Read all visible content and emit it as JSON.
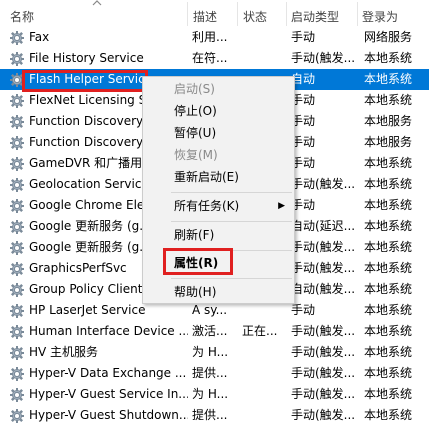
{
  "header": {
    "name": "名称",
    "desc": "描述",
    "status": "状态",
    "startup": "启动类型",
    "logon": "登录为"
  },
  "services": [
    {
      "name": "Fax",
      "desc": "利用...",
      "status": "",
      "startup": "手动",
      "logon": "网络服务"
    },
    {
      "name": "File History Service",
      "desc": "在符...",
      "status": "",
      "startup": "手动(触发...",
      "logon": "本地系统"
    },
    {
      "name": "Flash Helper Service",
      "desc": "",
      "status": "",
      "startup": "自动",
      "logon": "本地系统",
      "selected": true
    },
    {
      "name": "FlexNet Licensing Se...",
      "desc": "",
      "status": "",
      "startup": "手动",
      "logon": "本地系统"
    },
    {
      "name": "Function Discovery...",
      "desc": "",
      "status": "",
      "startup": "手动",
      "logon": "本地服务"
    },
    {
      "name": "Function Discovery...",
      "desc": "",
      "status": "",
      "startup": "手动",
      "logon": "本地服务"
    },
    {
      "name": "GameDVR 和广播用户...",
      "desc": "",
      "status": "",
      "startup": "手动",
      "logon": "本地系统"
    },
    {
      "name": "Geolocation Service",
      "desc": "",
      "status": "",
      "startup": "手动(触发...",
      "logon": "本地系统"
    },
    {
      "name": "Google Chrome Ele...",
      "desc": "",
      "status": "",
      "startup": "手动",
      "logon": "本地系统"
    },
    {
      "name": "Google 更新服务 (g...",
      "desc": "",
      "status": "",
      "startup": "自动(延迟...",
      "logon": "本地系统"
    },
    {
      "name": "Google 更新服务 (g...",
      "desc": "",
      "status": "",
      "startup": "手动(触发...",
      "logon": "本地系统"
    },
    {
      "name": "GraphicsPerfSvc",
      "desc": "",
      "status": "",
      "startup": "手动(触发...",
      "logon": "本地系统"
    },
    {
      "name": "Group Policy Client",
      "desc": "",
      "status": "",
      "startup": "自动(触发...",
      "logon": "本地系统"
    },
    {
      "name": "HP LaserJet Service",
      "desc": "A sy...",
      "status": "",
      "startup": "手动",
      "logon": "本地系统"
    },
    {
      "name": "Human Interface Device ...",
      "desc": "激活...",
      "status": "正在...",
      "startup": "手动(触发...",
      "logon": "本地系统"
    },
    {
      "name": "HV 主机服务",
      "desc": "为 H...",
      "status": "",
      "startup": "手动(触发...",
      "logon": "本地系统"
    },
    {
      "name": "Hyper-V Data Exchange ...",
      "desc": "提供...",
      "status": "",
      "startup": "手动(触发...",
      "logon": "本地系统"
    },
    {
      "name": "Hyper-V Guest Service In...",
      "desc": "为 H...",
      "status": "",
      "startup": "手动(触发...",
      "logon": "本地系统"
    },
    {
      "name": "Hyper-V Guest Shutdown...",
      "desc": "提供...",
      "status": "",
      "startup": "手动(触发...",
      "logon": "本地系统"
    }
  ],
  "menu": {
    "start": "启动(S)",
    "stop": "停止(O)",
    "pause": "暂停(U)",
    "resume": "恢复(M)",
    "restart": "重新启动(E)",
    "all_tasks": "所有任务(K)",
    "refresh": "刷新(F)",
    "properties": "属性(R)",
    "help": "帮助(H)"
  },
  "colors": {
    "selection": "#0078d7",
    "highlight_box": "#e02020"
  }
}
